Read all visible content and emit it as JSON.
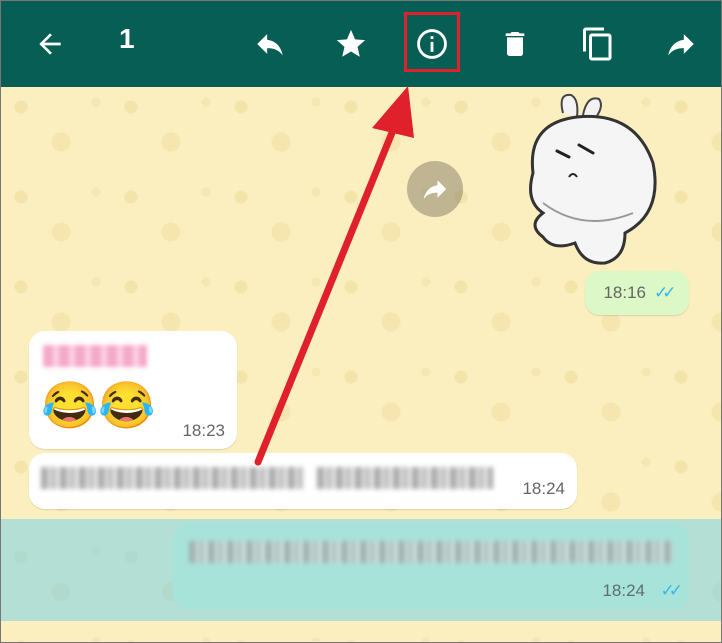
{
  "topbar": {
    "selected_count": "1",
    "colors": {
      "bar": "#075e54",
      "icon": "#ffffff",
      "highlight": "#e0202a"
    }
  },
  "messages": [
    {
      "type": "sticker",
      "direction": "outgoing",
      "time": "18:16",
      "status": "read"
    },
    {
      "type": "text",
      "direction": "incoming",
      "emoji": "😂😂",
      "time": "18:23"
    },
    {
      "type": "text",
      "direction": "incoming",
      "time": "18:24"
    },
    {
      "type": "text",
      "direction": "outgoing",
      "time": "18:24",
      "status": "read",
      "selected": true
    }
  ],
  "icons": [
    "back-arrow-icon",
    "reply-icon",
    "star-icon",
    "info-icon",
    "delete-icon",
    "copy-icon",
    "forward-icon"
  ]
}
